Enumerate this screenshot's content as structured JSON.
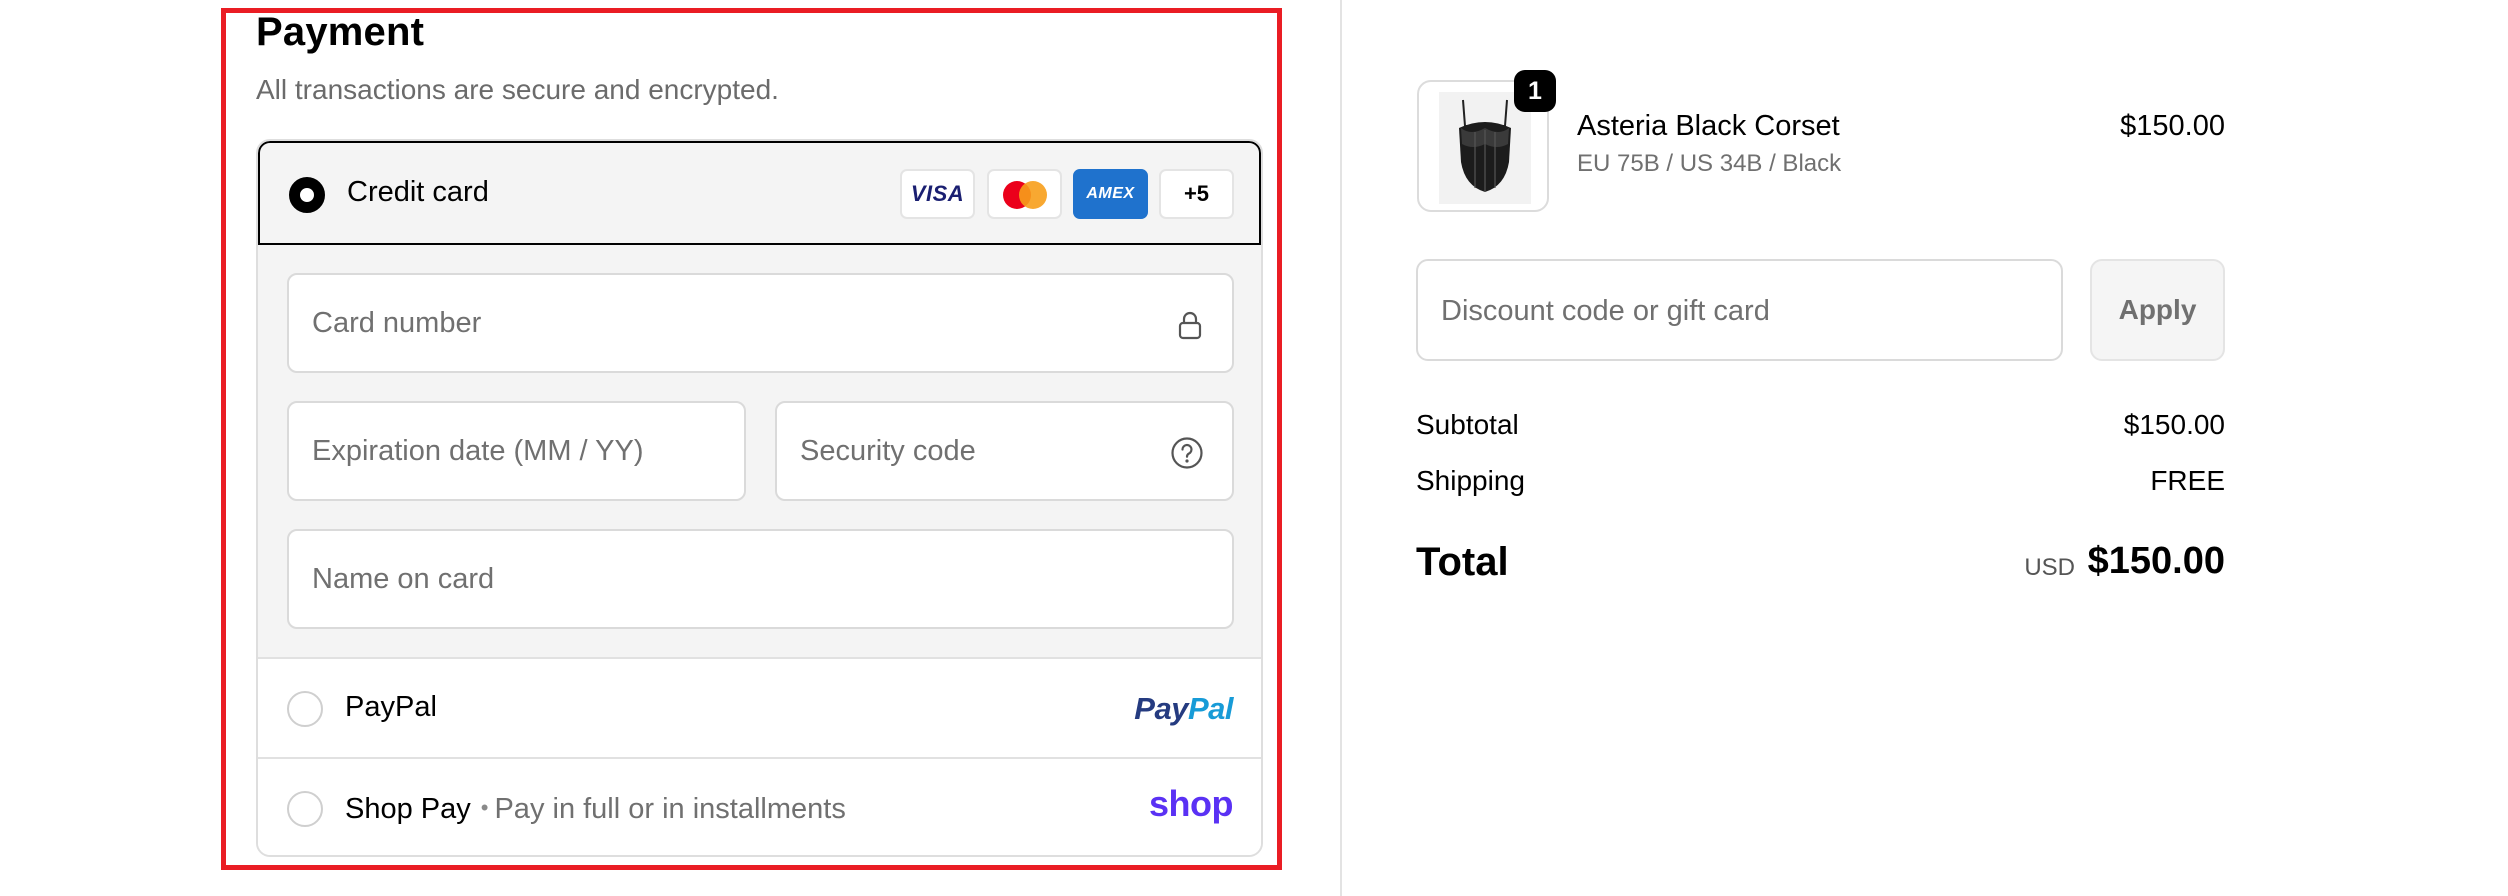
{
  "payment": {
    "title": "Payment",
    "subtitle": "All transactions are secure and encrypted.",
    "credit_card": {
      "label": "Credit card",
      "selected": true,
      "card_logos": [
        {
          "name": "visa-logo",
          "text": "VISA"
        },
        {
          "name": "mastercard-logo",
          "text": ""
        },
        {
          "name": "amex-logo",
          "text": "AMEX"
        },
        {
          "name": "more-cards-badge",
          "text": "+5"
        }
      ],
      "fields": {
        "card_number_placeholder": "Card number",
        "expiration_placeholder": "Expiration date (MM / YY)",
        "security_code_placeholder": "Security code",
        "name_on_card_placeholder": "Name on card"
      }
    },
    "paypal": {
      "label": "PayPal",
      "logo_part1": "Pay",
      "logo_part2": "Pal"
    },
    "shop_pay": {
      "label": "Shop Pay",
      "separator": "•",
      "sublabel": "Pay in full or in installments",
      "logo": "shop"
    }
  },
  "order_summary": {
    "item": {
      "quantity": "1",
      "name": "Asteria Black Corset",
      "variant": "EU 75B / US 34B / Black",
      "price": "$150.00"
    },
    "discount": {
      "placeholder": "Discount code or gift card",
      "apply_label": "Apply"
    },
    "subtotal_label": "Subtotal",
    "subtotal_value": "$150.00",
    "shipping_label": "Shipping",
    "shipping_value": "FREE",
    "total_label": "Total",
    "total_currency": "USD",
    "total_value": "$150.00"
  },
  "colors": {
    "highlight": "#ea1d24",
    "shop_brand": "#5a31f4",
    "paypal_dark": "#253b80",
    "paypal_light": "#179bd7",
    "amex": "#1f72cd",
    "visa": "#1a1f71"
  }
}
